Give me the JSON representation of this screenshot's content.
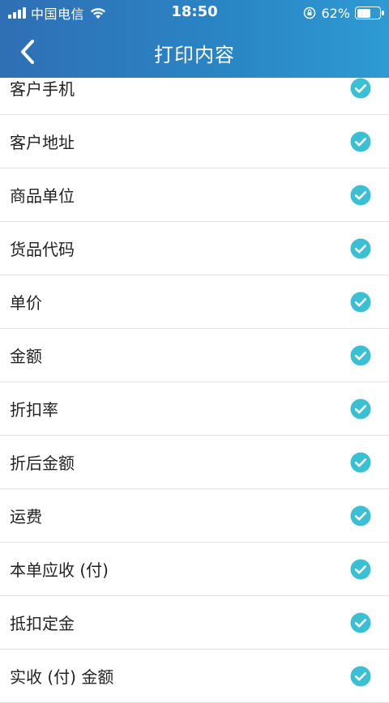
{
  "status_bar": {
    "carrier": "中国电信",
    "time": "18:50",
    "battery_percent_text": "62%",
    "battery_level": 0.62
  },
  "nav": {
    "back_icon": "chevron-left-icon",
    "title": "打印内容"
  },
  "colors": {
    "header_start": "#2f6fb4",
    "header_end": "#2e9ad3",
    "check": "#3bbfd3",
    "divider": "#e2e2e2",
    "text": "#222222"
  },
  "items": [
    {
      "label": "客户手机",
      "checked": true
    },
    {
      "label": "客户地址",
      "checked": true
    },
    {
      "label": "商品单位",
      "checked": true
    },
    {
      "label": "货品代码",
      "checked": true
    },
    {
      "label": "单价",
      "checked": true
    },
    {
      "label": "金额",
      "checked": true
    },
    {
      "label": "折扣率",
      "checked": true
    },
    {
      "label": "折后金额",
      "checked": true
    },
    {
      "label": "运费",
      "checked": true
    },
    {
      "label": "本单应收 (付)",
      "checked": true
    },
    {
      "label": "抵扣定金",
      "checked": true
    },
    {
      "label": "实收 (付) 金额",
      "checked": true
    }
  ]
}
